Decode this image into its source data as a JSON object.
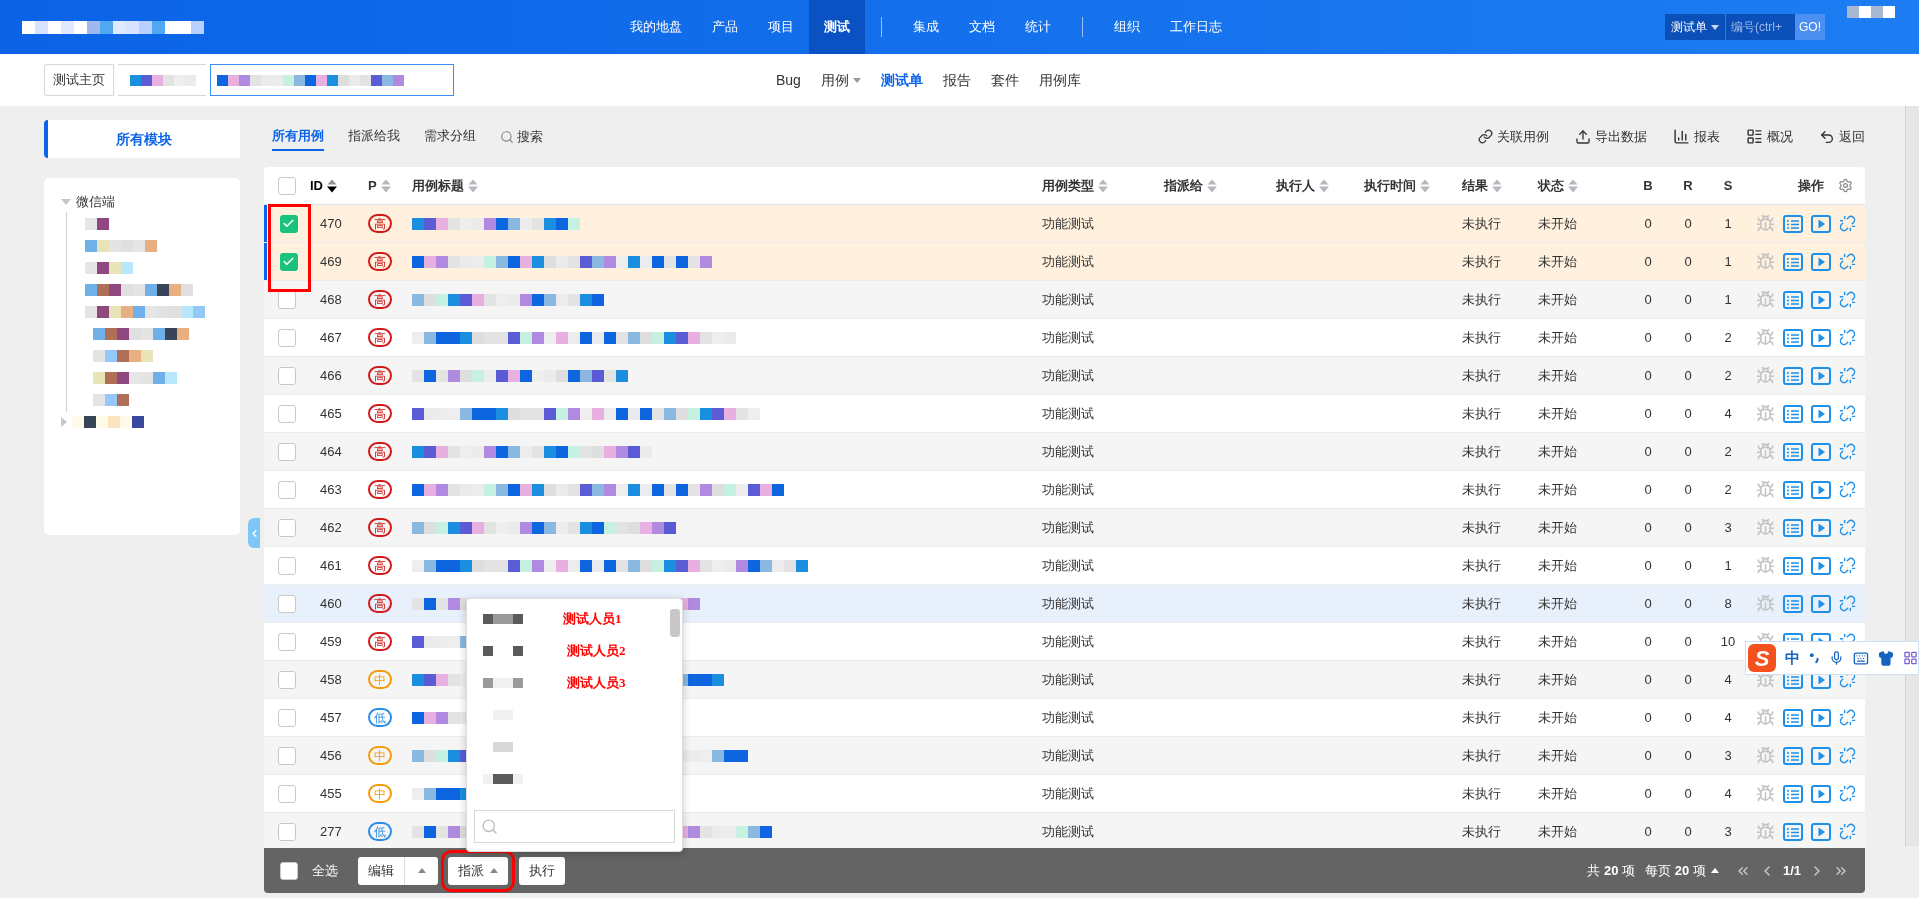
{
  "top_nav": {
    "items": [
      {
        "label": "我的地盘",
        "selected": false
      },
      {
        "label": "产品",
        "selected": false
      },
      {
        "label": "项目",
        "selected": false
      },
      {
        "label": "测试",
        "selected": true
      },
      {
        "label": "集成",
        "selected": false
      },
      {
        "label": "文档",
        "selected": false
      },
      {
        "label": "统计",
        "selected": false
      },
      {
        "label": "组织",
        "selected": false
      },
      {
        "label": "工作日志",
        "selected": false
      }
    ],
    "search": {
      "scope": "测试单",
      "placeholder": "编号(ctrl+",
      "button": "GO!"
    }
  },
  "breadcrumb": {
    "home": "测试主页"
  },
  "sub_nav": [
    {
      "label": "Bug",
      "selected": false,
      "has_menu": false
    },
    {
      "label": "用例",
      "selected": false,
      "has_menu": true
    },
    {
      "label": "测试单",
      "selected": true,
      "has_menu": false
    },
    {
      "label": "报告",
      "selected": false,
      "has_menu": false
    },
    {
      "label": "套件",
      "selected": false,
      "has_menu": false
    },
    {
      "label": "用例库",
      "selected": false,
      "has_menu": false
    }
  ],
  "sidebar": {
    "tab": "所有模块",
    "tree": [
      {
        "label": "微信端",
        "expanded": true
      }
    ]
  },
  "toolbar": {
    "tabs": [
      {
        "label": "所有用例",
        "selected": true
      },
      {
        "label": "指派给我",
        "selected": false
      },
      {
        "label": "需求分组",
        "selected": false
      }
    ],
    "search": "搜索",
    "actions": [
      "关联用例",
      "导出数据",
      "报表",
      "概况",
      "返回"
    ]
  },
  "table": {
    "all_checked": false,
    "columns": [
      {
        "label": "ID",
        "sortable": true,
        "sorted": true
      },
      {
        "label": "P",
        "sortable": true,
        "sorted": false
      },
      {
        "label": "用例标题",
        "sortable": true,
        "sorted": false
      },
      {
        "label": "用例类型",
        "sortable": true,
        "sorted": false
      },
      {
        "label": "指派给",
        "sortable": true,
        "sorted": false
      },
      {
        "label": "执行人",
        "sortable": true,
        "sorted": false
      },
      {
        "label": "执行时间",
        "sortable": true,
        "sorted": false
      },
      {
        "label": "结果",
        "sortable": true,
        "sorted": false
      },
      {
        "label": "状态",
        "sortable": true,
        "sorted": false
      },
      {
        "label": "B",
        "sortable": false,
        "sorted": false
      },
      {
        "label": "R",
        "sortable": false,
        "sorted": false
      },
      {
        "label": "S",
        "sortable": false,
        "sorted": false
      },
      {
        "label": "操作",
        "sortable": false,
        "sorted": false
      }
    ],
    "rows": [
      {
        "id": "470",
        "priority": "高",
        "color": "#d21818",
        "type": "功能测试",
        "result": "未执行",
        "status": "未开始",
        "b": "0",
        "r": "0",
        "s": "1",
        "checked": true,
        "highlighted": false
      },
      {
        "id": "469",
        "priority": "高",
        "color": "#d21818",
        "type": "功能测试",
        "result": "未执行",
        "status": "未开始",
        "b": "0",
        "r": "0",
        "s": "1",
        "checked": true,
        "highlighted": false
      },
      {
        "id": "468",
        "priority": "高",
        "color": "#d21818",
        "type": "功能测试",
        "result": "未执行",
        "status": "未开始",
        "b": "0",
        "r": "0",
        "s": "1",
        "checked": false,
        "highlighted": false
      },
      {
        "id": "467",
        "priority": "高",
        "color": "#d21818",
        "type": "功能测试",
        "result": "未执行",
        "status": "未开始",
        "b": "0",
        "r": "0",
        "s": "2",
        "checked": false,
        "highlighted": false
      },
      {
        "id": "466",
        "priority": "高",
        "color": "#d21818",
        "type": "功能测试",
        "result": "未执行",
        "status": "未开始",
        "b": "0",
        "r": "0",
        "s": "2",
        "checked": false,
        "highlighted": false
      },
      {
        "id": "465",
        "priority": "高",
        "color": "#d21818",
        "type": "功能测试",
        "result": "未执行",
        "status": "未开始",
        "b": "0",
        "r": "0",
        "s": "4",
        "checked": false,
        "highlighted": false
      },
      {
        "id": "464",
        "priority": "高",
        "color": "#d21818",
        "type": "功能测试",
        "result": "未执行",
        "status": "未开始",
        "b": "0",
        "r": "0",
        "s": "2",
        "checked": false,
        "highlighted": false
      },
      {
        "id": "463",
        "priority": "高",
        "color": "#d21818",
        "type": "功能测试",
        "result": "未执行",
        "status": "未开始",
        "b": "0",
        "r": "0",
        "s": "2",
        "checked": false,
        "highlighted": false
      },
      {
        "id": "462",
        "priority": "高",
        "color": "#d21818",
        "type": "功能测试",
        "result": "未执行",
        "status": "未开始",
        "b": "0",
        "r": "0",
        "s": "3",
        "checked": false,
        "highlighted": false
      },
      {
        "id": "461",
        "priority": "高",
        "color": "#d21818",
        "type": "功能测试",
        "result": "未执行",
        "status": "未开始",
        "b": "0",
        "r": "0",
        "s": "1",
        "checked": false,
        "highlighted": false
      },
      {
        "id": "460",
        "priority": "高",
        "color": "#d21818",
        "type": "功能测试",
        "result": "未执行",
        "status": "未开始",
        "b": "0",
        "r": "0",
        "s": "8",
        "checked": false,
        "highlighted": true
      },
      {
        "id": "459",
        "priority": "高",
        "color": "#d21818",
        "type": "功能测试",
        "result": "未执行",
        "status": "未开始",
        "b": "0",
        "r": "0",
        "s": "10",
        "checked": false,
        "highlighted": false
      },
      {
        "id": "458",
        "priority": "中",
        "color": "#f59a0c",
        "type": "功能测试",
        "result": "未执行",
        "status": "未开始",
        "b": "0",
        "r": "0",
        "s": "4",
        "checked": false,
        "highlighted": false
      },
      {
        "id": "457",
        "priority": "低",
        "color": "#2a8ee8",
        "type": "功能测试",
        "result": "未执行",
        "status": "未开始",
        "b": "0",
        "r": "0",
        "s": "4",
        "checked": false,
        "highlighted": false
      },
      {
        "id": "456",
        "priority": "中",
        "color": "#f59a0c",
        "type": "功能测试",
        "result": "未执行",
        "status": "未开始",
        "b": "0",
        "r": "0",
        "s": "3",
        "checked": false,
        "highlighted": false
      },
      {
        "id": "455",
        "priority": "中",
        "color": "#f59a0c",
        "type": "功能测试",
        "result": "未执行",
        "status": "未开始",
        "b": "0",
        "r": "0",
        "s": "4",
        "checked": false,
        "highlighted": false
      },
      {
        "id": "277",
        "priority": "低",
        "color": "#2a8ee8",
        "type": "功能测试",
        "result": "未执行",
        "status": "未开始",
        "b": "0",
        "r": "0",
        "s": "3",
        "checked": false,
        "highlighted": false
      }
    ]
  },
  "assign_dropdown": {
    "annotations": [
      "测试人员1",
      "测试人员2",
      "测试人员3"
    ]
  },
  "bulk_bar": {
    "select_all": "全选",
    "checked": false,
    "edit": "编辑",
    "assign": "指派",
    "run": "执行",
    "total": "共 **20** 项",
    "per_page": "每页 **20** 项",
    "page": "1/1"
  },
  "ime_toolbar": {
    "logo": "S",
    "mode": "中"
  }
}
